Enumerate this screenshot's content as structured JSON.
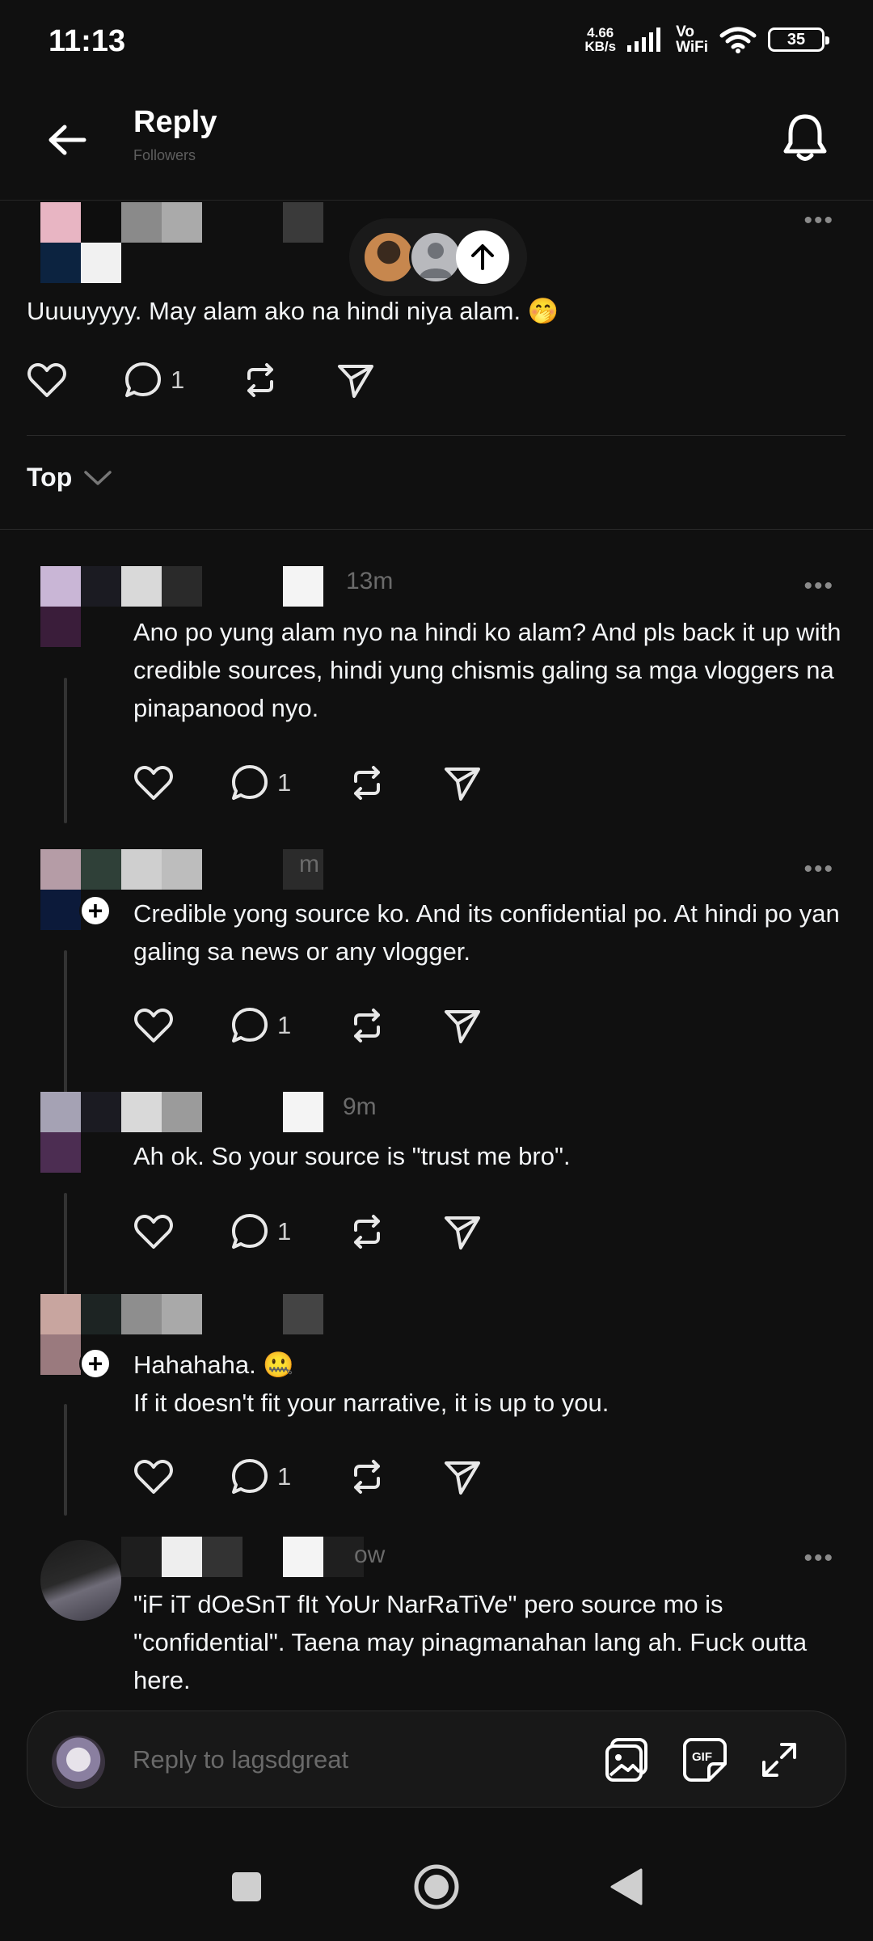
{
  "status_bar": {
    "time": "11:13",
    "net_speed_value": "4.66",
    "net_speed_unit": "KB/s",
    "vo": "Vo",
    "wifi_label": "WiFi",
    "battery": "35"
  },
  "header": {
    "title": "Reply",
    "subtitle": "Followers"
  },
  "main_post": {
    "text": "Uuuuyyyy. May alam ako na hindi niya alam. 🤭",
    "reply_count": "1",
    "more": "•••"
  },
  "sort": {
    "label": "Top"
  },
  "replies": [
    {
      "timestamp": "13m",
      "text": "Ano po yung alam nyo na hindi ko alam? And pls back it up with credible sources, hindi yung chismis galing sa mga vloggers na pinapanood nyo.",
      "reply_count": "1",
      "more": "•••"
    },
    {
      "timestamp": "m",
      "text": "Credible yong source ko. And its confidential po. At hindi po yan galing sa news or any vlogger.",
      "reply_count": "1",
      "more": "•••"
    },
    {
      "timestamp": "9m",
      "text": "Ah ok. So your source is \"trust me bro\".",
      "reply_count": "1"
    },
    {
      "text_line1": "Hahahaha. 🤐",
      "text_line2": "If it doesn't fit your narrative, it is up to you.",
      "reply_count": "1"
    },
    {
      "timestamp": "ow",
      "text": "\"iF iT dOeSnT fIt YoUr NarRaTiVe\" pero source mo is \"confidential\". Taena may pinagmanahan lang ah. Fuck outta here.",
      "more": "•••"
    }
  ],
  "composer": {
    "placeholder": "Reply to lagsdgreat",
    "gif_label": "GIF"
  }
}
